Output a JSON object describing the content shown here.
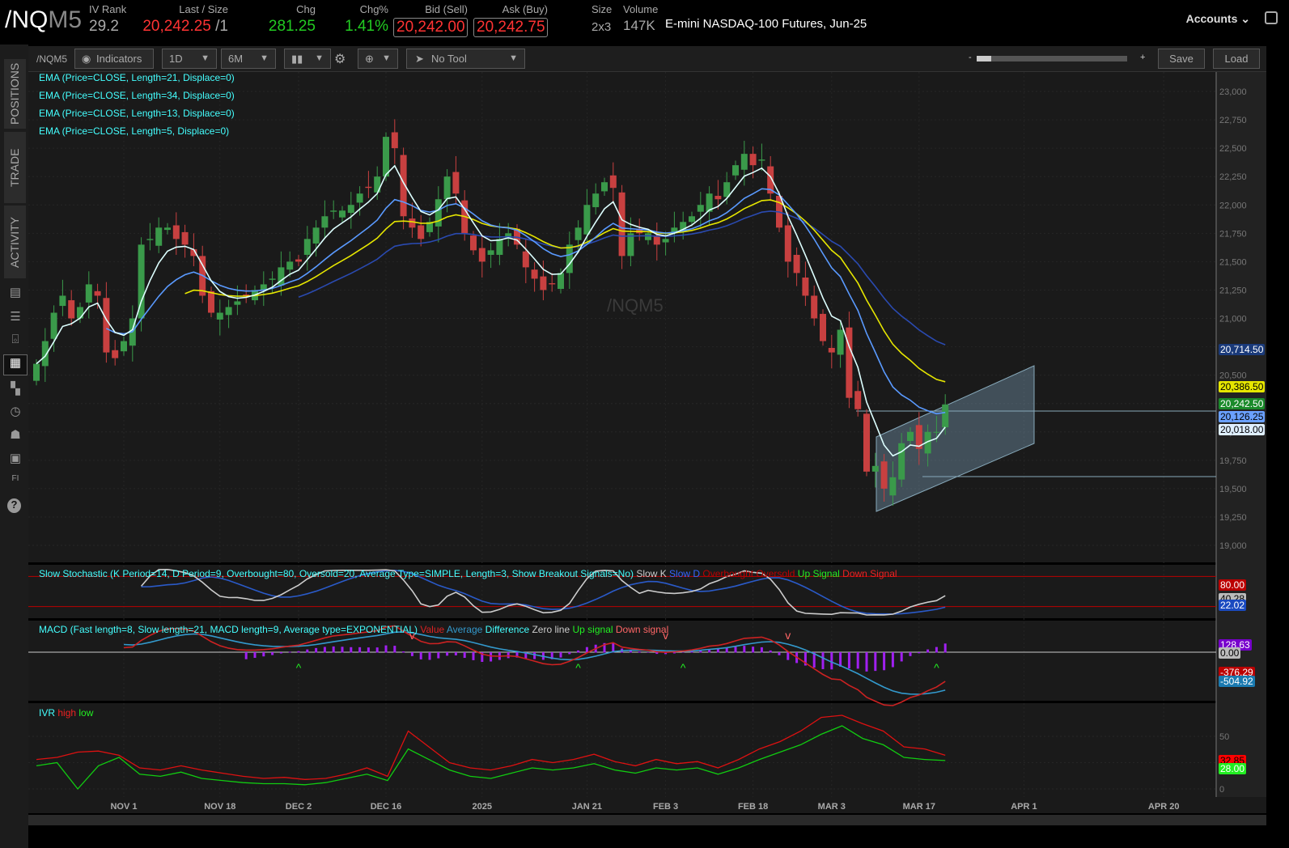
{
  "header": {
    "symbol_main": "/NQ",
    "symbol_suffix": "M5",
    "iv_rank_label": "IV Rank",
    "iv_rank": "29.2",
    "last_label": "Last / Size",
    "last": "20,242.25",
    "size": "/1",
    "chg_label": "Chg",
    "chg": "281.25",
    "chgp_label": "Chg%",
    "chgp": "1.41%",
    "bid_label": "Bid (Sell)",
    "bid": "20,242.00",
    "ask_label": "Ask (Buy)",
    "ask": "20,242.75",
    "sz_label": "Size",
    "sz": "2x3",
    "vol_label": "Volume",
    "vol": "147K",
    "desc": "E-mini NASDAQ-100 Futures, Jun-25",
    "accounts": "Accounts"
  },
  "sidebar": {
    "tabs": [
      "POSITIONS",
      "TRADE",
      "ACTIVITY"
    ],
    "icons": [
      "chart-book-icon",
      "list-icon",
      "tv-icon",
      "chart-grid-icon",
      "layout-icon",
      "clock-icon",
      "community-icon",
      "calendar-icon",
      "fi-icon",
      "help-icon"
    ]
  },
  "toolbar": {
    "symbol": "/NQM5",
    "indicators": "Indicators",
    "interval": "1D",
    "range": "6M",
    "tool": "No Tool",
    "zoom_minus": "-",
    "zoom_plus": "+",
    "save": "Save",
    "load": "Load"
  },
  "studies": [
    "EMA (Price=CLOSE, Length=21, Displace=0)",
    "EMA (Price=CLOSE, Length=34, Displace=0)",
    "EMA (Price=CLOSE, Length=13, Displace=0)",
    "EMA (Price=CLOSE, Length=5, Displace=0)"
  ],
  "watermark": "/NQM5",
  "price_tags": [
    {
      "v": "20,714.50",
      "bg": "#1a3a7a"
    },
    {
      "v": "20,386.50",
      "bg": "#e6e600",
      "fg": "#000"
    },
    {
      "v": "20,242.50",
      "bg": "#1a8a2a"
    },
    {
      "v": "20,126.25",
      "bg": "#6aa0ff",
      "fg": "#000"
    },
    {
      "v": "20,018.00",
      "bg": "#dfefff",
      "fg": "#000"
    }
  ],
  "stoch": {
    "title": "Slow Stochastic (K Period=14, D Period=9, Overbought=80, Oversold=20, Average Type=SIMPLE, Length=3, Show Breakout Signals=No)",
    "legend": [
      {
        "t": "Slow K",
        "c": "#ccc"
      },
      {
        "t": "Slow D",
        "c": "#36f"
      },
      {
        "t": "Overbought",
        "c": "#b00"
      },
      {
        "t": "Oversold",
        "c": "#b00"
      },
      {
        "t": "Up Signal",
        "c": "#2e2"
      },
      {
        "t": "Down Signal",
        "c": "#e22"
      }
    ],
    "tags": [
      {
        "v": "80.00",
        "bg": "#b00"
      },
      {
        "v": "40.28",
        "bg": "#bbb",
        "fg": "#000"
      },
      {
        "v": "22.02",
        "bg": "#1a4ac0"
      }
    ]
  },
  "macd": {
    "title": "MACD (Fast length=8, Slow length=21, MACD length=9, Average type=EXPONENTIAL)",
    "legend": [
      {
        "t": "Value",
        "c": "#d22"
      },
      {
        "t": "Average",
        "c": "#39c"
      },
      {
        "t": "Difference",
        "c": "#4ff"
      },
      {
        "t": "Zero line",
        "c": "#ccc"
      },
      {
        "t": "Up signal",
        "c": "#2e2"
      },
      {
        "t": "Down signal",
        "c": "#f66"
      }
    ],
    "tags": [
      {
        "v": "128.63",
        "bg": "#70c"
      },
      {
        "v": "0.00",
        "bg": "#bbb",
        "fg": "#000"
      },
      {
        "v": "-376.29",
        "bg": "#b00"
      },
      {
        "v": "-504.92",
        "bg": "#1a7ab0"
      }
    ]
  },
  "ivr": {
    "title": "IVR",
    "legend": [
      {
        "t": "high",
        "c": "#e22"
      },
      {
        "t": "low",
        "c": "#2e2"
      }
    ],
    "ticks": [
      "50",
      "0"
    ],
    "tags": [
      {
        "v": "32.85",
        "bg": "#f00",
        "fg": "#000"
      },
      {
        "v": "28.00",
        "bg": "#2e2"
      }
    ],
    "high": [
      28,
      30,
      35,
      36,
      32,
      20,
      18,
      22,
      18,
      15,
      12,
      10,
      11,
      9,
      10,
      14,
      20,
      12,
      55,
      40,
      25,
      20,
      18,
      22,
      28,
      25,
      28,
      33,
      26,
      22,
      28,
      24,
      26,
      20,
      28,
      38,
      45,
      55,
      68,
      70,
      62,
      55,
      40,
      38,
      32
    ],
    "low": [
      22,
      25,
      0,
      22,
      30,
      14,
      12,
      16,
      10,
      8,
      6,
      5,
      5,
      4,
      6,
      10,
      14,
      8,
      38,
      28,
      18,
      12,
      10,
      15,
      20,
      18,
      20,
      24,
      18,
      15,
      20,
      18,
      20,
      14,
      20,
      28,
      35,
      42,
      52,
      60,
      48,
      42,
      30,
      28,
      27
    ]
  },
  "chart_data": {
    "type": "candlestick",
    "ylim": [
      19000,
      23000
    ],
    "yticks": [
      "23,000",
      "22,750",
      "22,500",
      "22,250",
      "22,000",
      "21,750",
      "21,500",
      "21,250",
      "21,000",
      "20,750",
      "20,500",
      "20,250",
      "20,000",
      "19,750",
      "19,500",
      "19,250",
      "19,000"
    ],
    "xticks": [
      {
        "t": "NOV 1",
        "b": 10
      },
      {
        "t": "NOV 18",
        "b": 21
      },
      {
        "t": "DEC 2",
        "b": 30
      },
      {
        "t": "DEC 16",
        "b": 40
      },
      {
        "t": "2025",
        "b": 51
      },
      {
        "t": "JAN 21",
        "b": 63
      },
      {
        "t": "FEB 3",
        "b": 72
      },
      {
        "t": "FEB 18",
        "b": 82
      },
      {
        "t": "MAR 3",
        "b": 91
      },
      {
        "t": "MAR 17",
        "b": 101
      },
      {
        "t": "APR 1",
        "b": 113
      },
      {
        "t": "APR 20",
        "b": 129
      }
    ],
    "closes": [
      20600,
      20800,
      21050,
      21200,
      21000,
      21100,
      21300,
      21200,
      20700,
      20650,
      20800,
      21000,
      21650,
      21700,
      21800,
      21800,
      21700,
      21650,
      21550,
      21200,
      21050,
      21050,
      21100,
      21150,
      21200,
      21250,
      21300,
      21350,
      21450,
      21500,
      21500,
      21700,
      21800,
      21900,
      21950,
      21950,
      22000,
      22100,
      22150,
      22250,
      22600,
      22500,
      21900,
      21800,
      21700,
      21850,
      22050,
      22250,
      22100,
      21750,
      21600,
      21500,
      21600,
      21700,
      21750,
      21650,
      21450,
      21350,
      21250,
      21300,
      21400,
      21650,
      21800,
      22000,
      22100,
      22200,
      22150,
      21550,
      21750,
      21750,
      21750,
      21650,
      21700,
      21800,
      21850,
      21900,
      22000,
      22100,
      22050,
      22200,
      22350,
      22450,
      22350,
      22400,
      22100,
      21800,
      21500,
      21400,
      21200,
      21000,
      20800,
      20700,
      20900,
      20300,
      20200,
      19650,
      19700,
      19500,
      19600,
      19900,
      20000,
      19850,
      20000,
      20000,
      20242
    ]
  }
}
